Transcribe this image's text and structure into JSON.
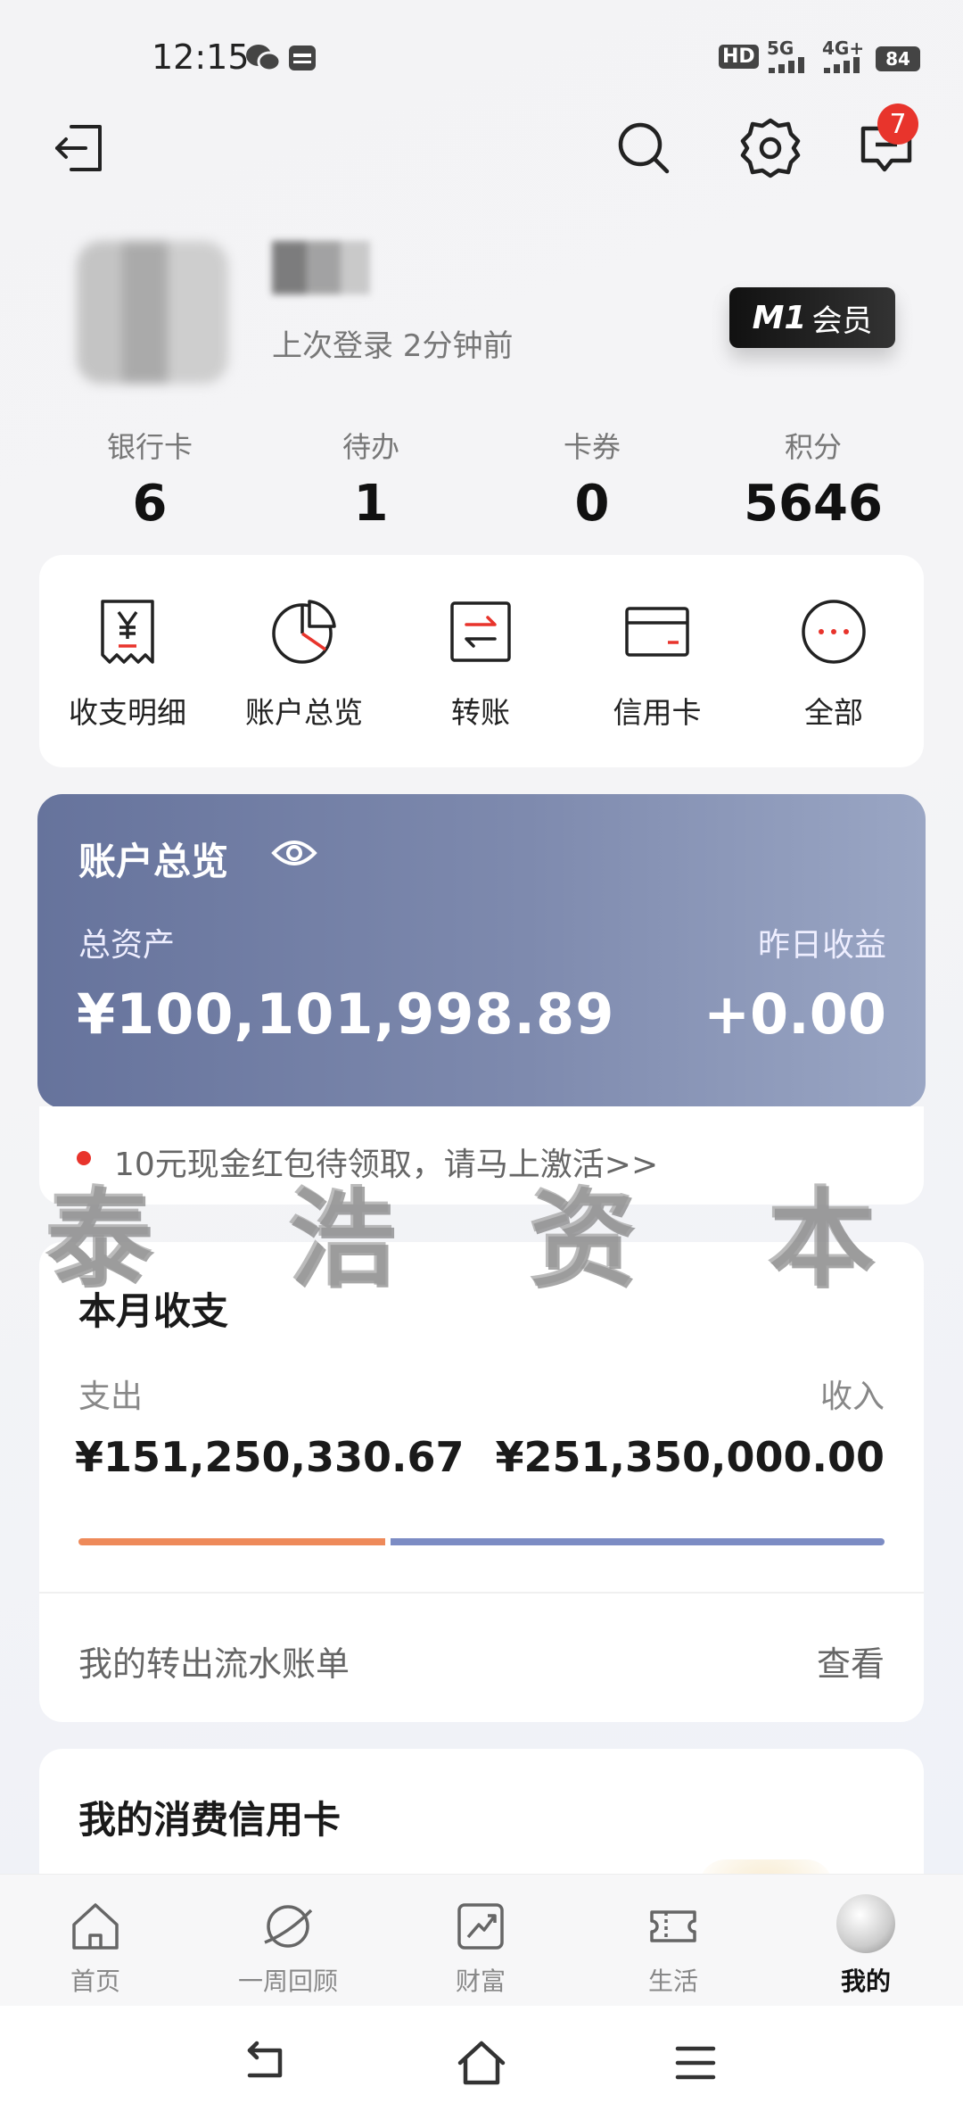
{
  "status": {
    "time": "12:15",
    "battery": "84",
    "network_5g": "5G",
    "network_4g": "4G+",
    "hd": "HD"
  },
  "header": {
    "notification_count": "7"
  },
  "profile": {
    "last_login": "上次登录 2分钟前",
    "member_badge_prefix": "M1",
    "member_badge_label": "会员"
  },
  "stats": [
    {
      "label": "银行卡",
      "value": "6"
    },
    {
      "label": "待办",
      "value": "1"
    },
    {
      "label": "卡券",
      "value": "0"
    },
    {
      "label": "积分",
      "value": "5646"
    }
  ],
  "quick_menu": [
    {
      "label": "收支明细",
      "icon": "receipt-icon"
    },
    {
      "label": "账户总览",
      "icon": "pie-chart-icon"
    },
    {
      "label": "转账",
      "icon": "transfer-icon"
    },
    {
      "label": "信用卡",
      "icon": "credit-card-icon"
    },
    {
      "label": "全部",
      "icon": "more-icon"
    }
  ],
  "overview": {
    "title": "账户总览",
    "total_assets_label": "总资产",
    "total_assets": "¥100,101,998.89",
    "yesterday_label": "昨日收益",
    "yesterday_value": "+0.00"
  },
  "promo": {
    "text": "10元现金红包待领取，请马上激活>>"
  },
  "watermark": {
    "chars": [
      "泰",
      "浩",
      "资",
      "本"
    ]
  },
  "monthly": {
    "title": "本月收支",
    "expense_label": "支出",
    "expense": "¥151,250,330.67",
    "income_label": "收入",
    "income": "¥251,350,000.00",
    "expense_share": 0.38,
    "expense_color": "#ee8a5a",
    "income_color": "#7c8cc4",
    "ledger_label": "我的转出流水账单",
    "view_label": "查看"
  },
  "credit": {
    "title": "我的消费信用卡"
  },
  "nav": [
    {
      "label": "首页",
      "icon": "home-icon"
    },
    {
      "label": "一周回顾",
      "icon": "planet-icon"
    },
    {
      "label": "财富",
      "icon": "wealth-chart-icon"
    },
    {
      "label": "生活",
      "icon": "ticket-icon"
    },
    {
      "label": "我的",
      "icon": "avatar"
    }
  ]
}
